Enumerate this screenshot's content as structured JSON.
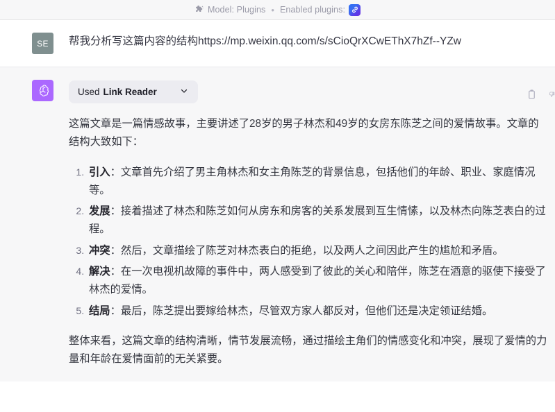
{
  "top_bar": {
    "puzzle_icon": "puzzle-plugin-icon",
    "model_label": "Model: Plugins",
    "separator": "•",
    "enabled_plugins_label": "Enabled plugins:",
    "plugin_badge_icon": "link-reader-plugin-icon",
    "plugin_badge_gradient_from": "#2b6cf6",
    "plugin_badge_gradient_to": "#6a2fe0"
  },
  "user_message": {
    "avatar_initials": "SE",
    "avatar_color": "#7f8f8f",
    "text": "帮我分析写这篇内容的结构https://mp.weixin.qq.com/s/sCioQrXCwEThX7hZf--YZw"
  },
  "assistant_message": {
    "avatar_icon": "openai-logo-icon",
    "avatar_color": "#ab68ff",
    "plugin_call": {
      "prefix": "Used",
      "plugin_name": "Link Reader",
      "chevron_icon": "chevron-down-icon"
    },
    "intro_paragraph": "这篇文章是一篇情感故事，主要讲述了28岁的男子林杰和49岁的女房东陈芝之间的爱情故事。文章的结构大致如下：",
    "structure_list": [
      {
        "term": "引入",
        "colon": "：",
        "detail": "文章首先介绍了男主角林杰和女主角陈芝的背景信息，包括他们的年龄、职业、家庭情况等。"
      },
      {
        "term": "发展",
        "colon": "：",
        "detail": "接着描述了林杰和陈芝如何从房东和房客的关系发展到互生情愫，以及林杰向陈芝表白的过程。"
      },
      {
        "term": "冲突",
        "colon": "：",
        "detail": "然后，文章描绘了陈芝对林杰表白的拒绝，以及两人之间因此产生的尴尬和矛盾。"
      },
      {
        "term": "解决",
        "colon": "：",
        "detail": "在一次电视机故障的事件中，两人感受到了彼此的关心和陪伴，陈芝在酒意的驱使下接受了林杰的爱情。"
      },
      {
        "term": "结局",
        "colon": "：",
        "detail": "最后，陈芝提出要嫁给林杰，尽管双方家人都反对，但他们还是决定领证结婚。"
      }
    ],
    "closing_paragraph": "整体来看，这篇文章的结构清晰，情节发展流畅，通过描绘主角们的情感变化和冲突，展现了爱情的力量和年龄在爱情面前的无关紧要。",
    "actions": [
      {
        "icon": "copy-clipboard-icon"
      },
      {
        "icon": "thumbs-down-icon"
      }
    ]
  }
}
